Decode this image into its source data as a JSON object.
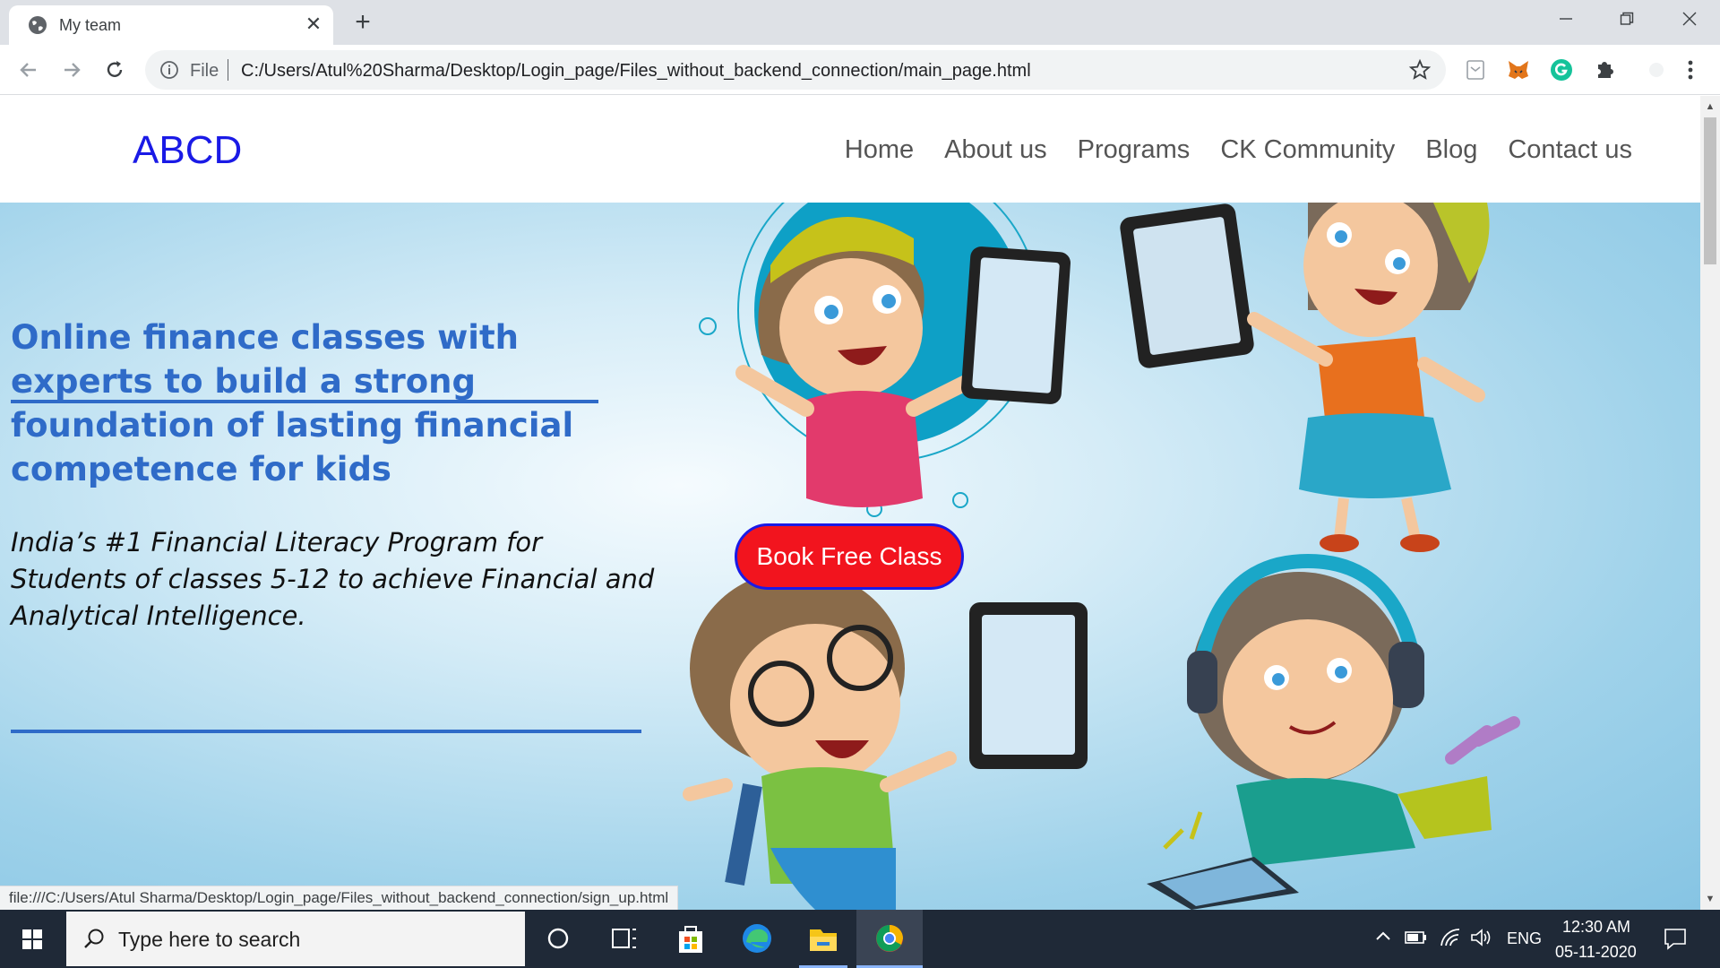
{
  "browser": {
    "tab_title": "My team",
    "tab_close": "✕",
    "new_tab": "+",
    "omnibox_scheme": "File",
    "url": "C:/Users/Atul%20Sharma/Desktop/Login_page/Files_without_backend_connection/main_page.html",
    "status_url": "file:///C:/Users/Atul Sharma/Desktop/Login_page/Files_without_backend_connection/sign_up.html"
  },
  "site": {
    "logo": "ABCD",
    "nav": [
      "Home",
      "About us",
      "Programs",
      "CK Community",
      "Blog",
      "Contact us"
    ],
    "hero_title": "Online finance classes with experts to build a strong foundation of lasting financial competence for kids",
    "hero_subtitle": "India’s #1 Financial Literacy Program for Students of classes 5-12 to achieve Financial and Analytical Intelligence.",
    "cta_label": "Book Free Class"
  },
  "taskbar": {
    "search_placeholder": "Type here to search",
    "language": "ENG",
    "time": "12:30 AM",
    "date": "05-11-2020"
  },
  "colors": {
    "brand_blue": "#1a1ae6",
    "hero_text": "#2f6bc8",
    "cta_red": "#f2141e"
  }
}
